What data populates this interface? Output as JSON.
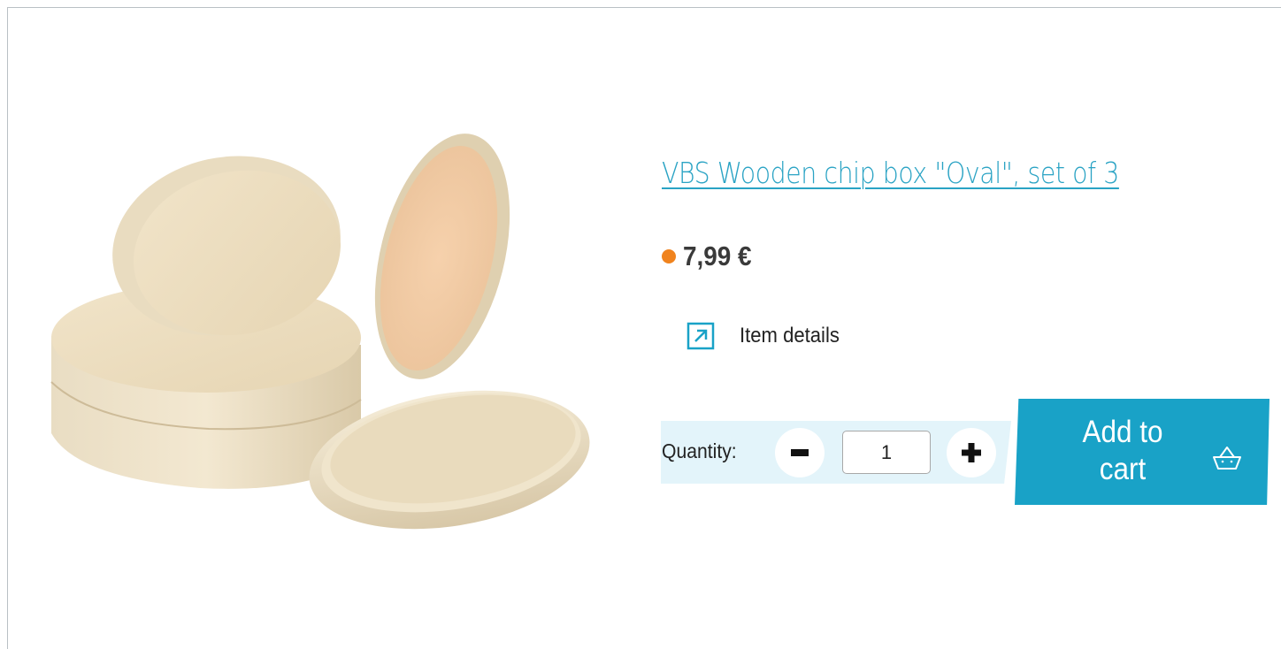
{
  "product": {
    "title": "VBS Wooden chip box \"Oval\", set of 3",
    "price": "7,99 €",
    "availability_color": "#f0831e",
    "image_icon": "wooden-oval-boxes-image"
  },
  "details": {
    "label": "Item details",
    "icon": "external-arrow-icon"
  },
  "quantity": {
    "label": "Quantity:",
    "value": "1",
    "minus_symbol": "minus-icon",
    "plus_symbol": "plus-icon"
  },
  "cart": {
    "label": "Add to cart",
    "icon": "basket-icon"
  },
  "colors": {
    "accent": "#19a2c7",
    "title_link": "#2aa3c4",
    "quantity_band": "#e3f4fa",
    "frame_border": "#b9c0c4"
  }
}
